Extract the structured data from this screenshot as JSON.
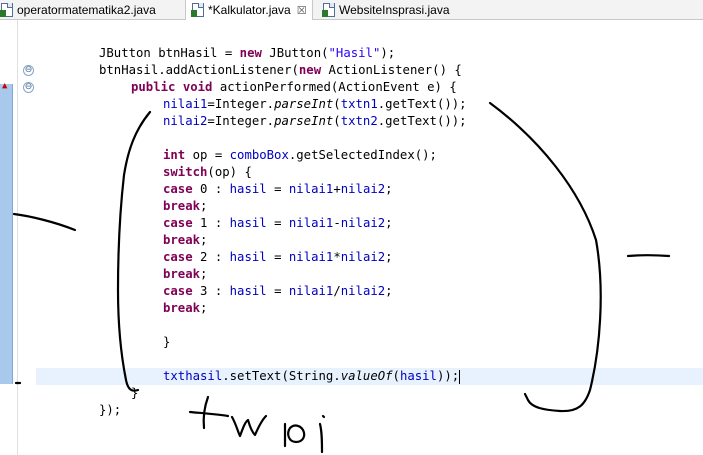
{
  "tabs": [
    {
      "label": "operatormatematika2.java",
      "active": false
    },
    {
      "label": "*Kalkulator.java",
      "active": true,
      "close": "☒"
    },
    {
      "label": "WebsiteInsprasi.java",
      "active": false
    }
  ],
  "code": {
    "l1": {
      "a": "JButton btnHasil = ",
      "kw": "new",
      "b": " JButton(",
      "s": "\"Hasil\"",
      "c": ");"
    },
    "l2": {
      "a": "btnHasil.addActionListener(",
      "kw": "new",
      "b": " ActionListener() {"
    },
    "l3": {
      "kw1": "public",
      "kw2": "void",
      "b": " actionPerformed(ActionEvent e) {"
    },
    "l4": {
      "f1": "nilai1",
      "a": "=Integer.",
      "m": "parseInt",
      "b": "(",
      "f2": "txtn1",
      "c": ".getText());"
    },
    "l5": {
      "f1": "nilai2",
      "a": "=Integer.",
      "m": "parseInt",
      "b": "(",
      "f2": "txtn2",
      "c": ".getText());"
    },
    "l6": {
      "kw": "int",
      "a": " op = ",
      "f": "comboBox",
      "b": ".getSelectedIndex();"
    },
    "l7": {
      "kw": "switch",
      "b": "(op) {"
    },
    "l8": {
      "kw": "case",
      "a": " 0 : ",
      "f1": "hasil",
      "b": " = ",
      "f2": "nilai1",
      "op": "+",
      "f3": "nilai2",
      "c": ";"
    },
    "l9": {
      "kw": "break",
      "c": ";"
    },
    "l10": {
      "kw": "case",
      "a": " 1 : ",
      "f1": "hasil",
      "b": " = ",
      "f2": "nilai1",
      "op": "-",
      "f3": "nilai2",
      "c": ";"
    },
    "l11": {
      "kw": "break",
      "c": ";"
    },
    "l12": {
      "kw": "case",
      "a": " 2 : ",
      "f1": "hasil",
      "b": " = ",
      "f2": "nilai1",
      "op": "*",
      "f3": "nilai2",
      "c": ";"
    },
    "l13": {
      "kw": "break",
      "c": ";"
    },
    "l14": {
      "kw": "case",
      "a": " 3 : ",
      "f1": "hasil",
      "b": " = ",
      "f2": "nilai1",
      "op": "/",
      "f3": "nilai2",
      "c": ";"
    },
    "l15": {
      "kw": "break",
      "c": ";"
    },
    "l16": {
      "a": "}"
    },
    "l17": {
      "f1": "txthasil",
      "a": ".setText(String.",
      "m": "valueOf",
      "b": "(",
      "f2": "hasil",
      "c": "));"
    },
    "l18": {
      "a": "}"
    },
    "l19": {
      "a": "});"
    }
  },
  "gutter": {
    "fold_symbol": "⊖"
  },
  "colors": {
    "keyword": "#7f0055",
    "string": "#2a00ff",
    "field": "#0000c0",
    "current_line": "#e8f2fe"
  }
}
